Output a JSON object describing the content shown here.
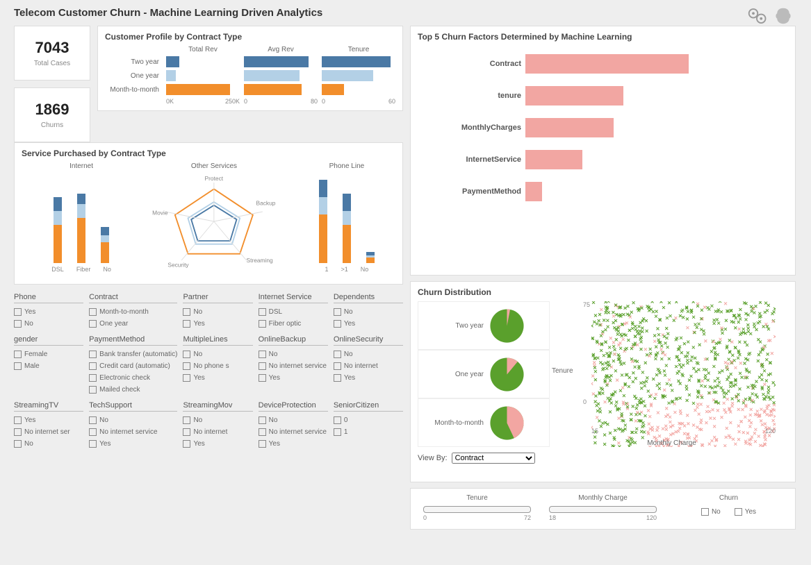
{
  "title": "Telecom Customer Churn - Machine Learning Driven Analytics",
  "icons": {
    "gears": "gears-icon",
    "brain": "brain-icon"
  },
  "kpi": {
    "total_cases": {
      "value": "7043",
      "label": "Total Cases"
    },
    "churns": {
      "value": "1869",
      "label": "Churns"
    }
  },
  "customer_profile": {
    "title": "Customer Profile by Contract Type",
    "headers": [
      "Total Rev",
      "Avg Rev",
      "Tenure"
    ],
    "rows": [
      "Two year",
      "One year",
      "Month-to-month"
    ],
    "axis": [
      [
        "0K",
        "250K"
      ],
      [
        "0",
        "80"
      ],
      [
        "0",
        "60"
      ]
    ]
  },
  "service_purchased": {
    "title": "Service Purchased by Contract Type",
    "internet": {
      "title": "Internet",
      "cats": [
        "DSL",
        "Fiber",
        "No"
      ]
    },
    "other": {
      "title": "Other Services",
      "axes": [
        "Protect",
        "Backup",
        "Streaming",
        "Security",
        "Movie"
      ]
    },
    "phone": {
      "title": "Phone Line",
      "cats": [
        "1",
        ">1",
        "No"
      ]
    }
  },
  "filters": [
    {
      "name": "Phone",
      "opts": [
        "Yes",
        "No"
      ]
    },
    {
      "name": "Contract",
      "opts": [
        "Month-to-month",
        "One year"
      ]
    },
    {
      "name": "Partner",
      "opts": [
        "No",
        "Yes"
      ]
    },
    {
      "name": "Internet Service",
      "opts": [
        "DSL",
        "Fiber optic"
      ]
    },
    {
      "name": "Dependents",
      "opts": [
        "No",
        "Yes"
      ]
    },
    {
      "name": "gender",
      "opts": [
        "Female",
        "Male"
      ]
    },
    {
      "name": "PaymentMethod",
      "opts": [
        "Bank transfer (automatic)",
        "Credit card (automatic)",
        "Electronic check",
        "Mailed check"
      ]
    },
    {
      "name": "MultipleLines",
      "opts": [
        "No",
        "No phone s",
        "Yes"
      ]
    },
    {
      "name": "OnlineBackup",
      "opts": [
        "No",
        "No internet service",
        "Yes"
      ]
    },
    {
      "name": "OnlineSecurity",
      "opts": [
        "No",
        "No internet",
        "Yes"
      ]
    },
    {
      "name": "StreamingTV",
      "opts": [
        "Yes",
        "No internet ser",
        "No"
      ]
    },
    {
      "name": "TechSupport",
      "opts": [
        "No",
        "No internet service",
        "Yes"
      ]
    },
    {
      "name": "StreamingMov",
      "opts": [
        "No",
        "No internet",
        "Yes"
      ]
    },
    {
      "name": "DeviceProtection",
      "opts": [
        "No",
        "No internet service",
        "Yes"
      ]
    },
    {
      "name": "SeniorCitizen",
      "opts": [
        "0",
        "1"
      ]
    }
  ],
  "factors": {
    "title": "Top 5 Churn Factors Determined by Machine Learning",
    "items": [
      {
        "label": "Contract",
        "val": 100
      },
      {
        "label": "tenure",
        "val": 60
      },
      {
        "label": "MonthlyCharges",
        "val": 54
      },
      {
        "label": "InternetService",
        "val": 35
      },
      {
        "label": "PaymentMethod",
        "val": 10
      }
    ]
  },
  "distribution": {
    "title": "Churn Distribution",
    "pies": [
      {
        "label": "Two year",
        "churn": 3
      },
      {
        "label": "One year",
        "churn": 11
      },
      {
        "label": "Month-to-month",
        "churn": 43
      }
    ],
    "view_by_label": "View By:",
    "view_by_value": "Contract",
    "scatter": {
      "ylabel": "Tenure",
      "xlabel": "Monthly Charge",
      "y": [
        0,
        75
      ],
      "x": [
        15,
        120
      ]
    }
  },
  "sliders": {
    "tenure": {
      "label": "Tenure",
      "min": "0",
      "max": "72"
    },
    "monthly": {
      "label": "Monthly Charge",
      "min": "18",
      "max": "120"
    },
    "churn": {
      "label": "Churn",
      "opts": [
        "No",
        "Yes"
      ]
    }
  },
  "chart_data": {
    "customer_profile": {
      "type": "bar",
      "series": [
        {
          "name": "Total Rev",
          "categories": [
            "Two year",
            "One year",
            "Month-to-month"
          ],
          "values": [
            55000,
            40000,
            260000
          ],
          "unit": "K",
          "xlim": [
            0,
            300000
          ]
        },
        {
          "name": "Avg Rev",
          "categories": [
            "Two year",
            "One year",
            "Month-to-month"
          ],
          "values": [
            70,
            60,
            62
          ],
          "xlim": [
            0,
            80
          ]
        },
        {
          "name": "Tenure",
          "categories": [
            "Two year",
            "One year",
            "Month-to-month"
          ],
          "values": [
            56,
            42,
            18
          ],
          "xlim": [
            0,
            60
          ]
        }
      ],
      "colors": {
        "Two year": "#4a79a5",
        "One year": "#b3d0e6",
        "Month-to-month": "#f28e2b"
      }
    },
    "service_internet": {
      "type": "bar",
      "stacked": true,
      "categories": [
        "DSL",
        "Fiber",
        "No"
      ],
      "series": [
        {
          "name": "Month-to-month",
          "values": [
            55,
            65,
            30
          ]
        },
        {
          "name": "One year",
          "values": [
            20,
            20,
            10
          ]
        },
        {
          "name": "Two year",
          "values": [
            20,
            15,
            12
          ]
        }
      ]
    },
    "service_phone": {
      "type": "bar",
      "stacked": true,
      "categories": [
        "1",
        ">1",
        "No"
      ],
      "series": [
        {
          "name": "Month-to-month",
          "values": [
            70,
            55,
            8
          ]
        },
        {
          "name": "One year",
          "values": [
            25,
            20,
            3
          ]
        },
        {
          "name": "Two year",
          "values": [
            25,
            25,
            5
          ]
        }
      ]
    },
    "service_other": {
      "type": "radar",
      "axes": [
        "Protect",
        "Backup",
        "Streaming",
        "Security",
        "Movie"
      ],
      "series": [
        {
          "name": "Month-to-month",
          "values": [
            0.85,
            0.65,
            0.55,
            0.45,
            0.6
          ],
          "color": "#f28e2b"
        },
        {
          "name": "One year",
          "values": [
            0.55,
            0.5,
            0.45,
            0.4,
            0.48
          ],
          "color": "#b3d0e6"
        },
        {
          "name": "Two year",
          "values": [
            0.5,
            0.48,
            0.42,
            0.38,
            0.45
          ],
          "color": "#4a79a5"
        }
      ]
    },
    "churn_factors": {
      "type": "bar",
      "orientation": "h",
      "categories": [
        "Contract",
        "tenure",
        "MonthlyCharges",
        "InternetService",
        "PaymentMethod"
      ],
      "values": [
        100,
        60,
        54,
        35,
        10
      ],
      "color": "#f2a6a2"
    },
    "churn_pies": [
      {
        "label": "Two year",
        "type": "pie",
        "slices": [
          {
            "name": "No",
            "value": 97,
            "color": "#5aa02c"
          },
          {
            "name": "Yes",
            "value": 3,
            "color": "#f2a6a2"
          }
        ]
      },
      {
        "label": "One year",
        "type": "pie",
        "slices": [
          {
            "name": "No",
            "value": 89,
            "color": "#5aa02c"
          },
          {
            "name": "Yes",
            "value": 11,
            "color": "#f2a6a2"
          }
        ]
      },
      {
        "label": "Month-to-month",
        "type": "pie",
        "slices": [
          {
            "name": "No",
            "value": 57,
            "color": "#5aa02c"
          },
          {
            "name": "Yes",
            "value": 43,
            "color": "#f2a6a2"
          }
        ]
      }
    ],
    "scatter": {
      "type": "scatter",
      "xlabel": "Monthly Charge",
      "ylabel": "Tenure",
      "xlim": [
        15,
        120
      ],
      "ylim": [
        0,
        75
      ],
      "series": [
        {
          "name": "No",
          "color": "#5aa02c",
          "marker": "x"
        },
        {
          "name": "Yes",
          "color": "#f2a6a2",
          "marker": "x"
        }
      ],
      "note": "~7000 points dense across range; higher churn at low tenure and mid-high charge"
    }
  }
}
